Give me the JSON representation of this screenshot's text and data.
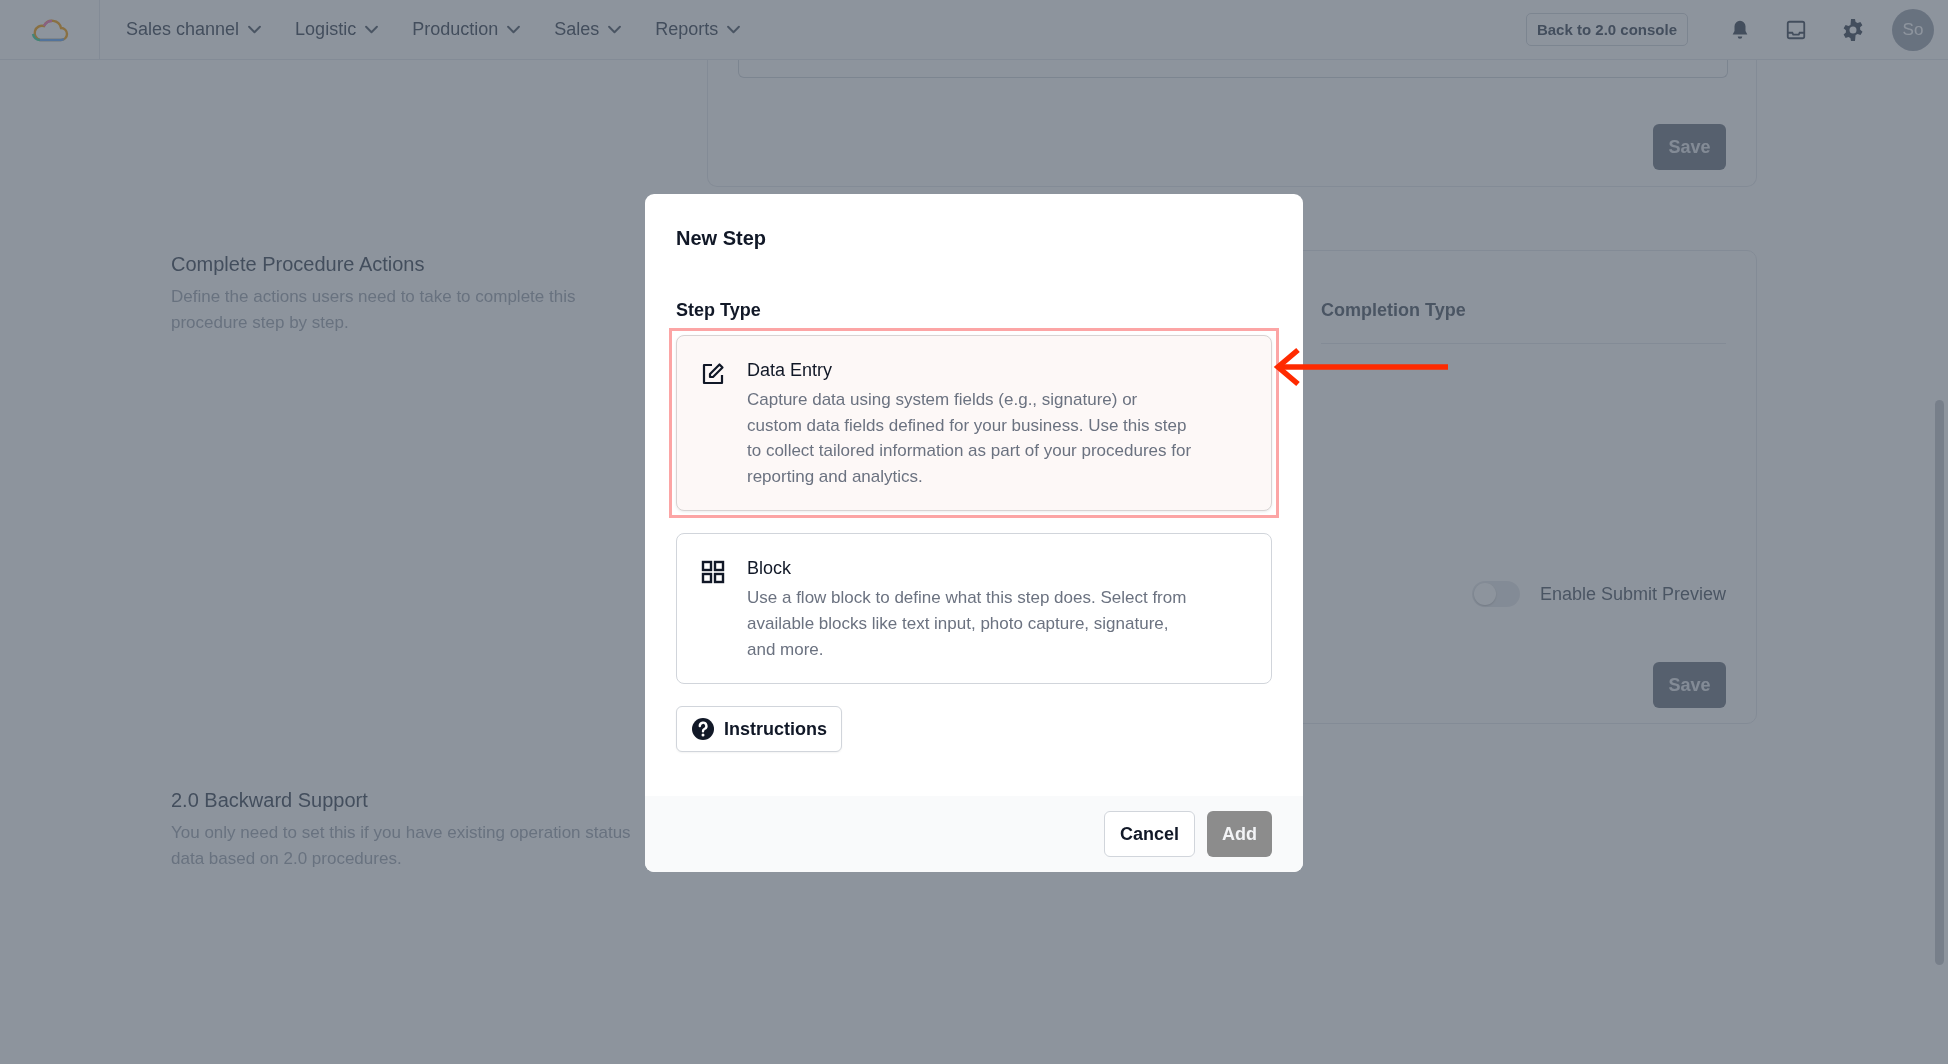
{
  "nav": {
    "items": [
      {
        "label": "Sales channel"
      },
      {
        "label": "Logistic"
      },
      {
        "label": "Production"
      },
      {
        "label": "Sales"
      },
      {
        "label": "Reports"
      }
    ],
    "console_button": "Back to 2.0 console",
    "avatar": "So"
  },
  "sections": [
    {
      "title": "Complete Procedure Actions",
      "description": "Define the actions users need to take to complete this procedure step by step."
    },
    {
      "title": "2.0 Backward Support",
      "description": "You only need to set this if you have existing operation status data based on 2.0 procedures."
    }
  ],
  "top_card": {
    "save_button": "Save"
  },
  "completion_card": {
    "column_header": "Completion Type",
    "toggle": {
      "label": "Enable Submit Preview",
      "on": false
    },
    "save_button": "Save"
  },
  "modal": {
    "title": "New Step",
    "section_label": "Step Type",
    "step_types": [
      {
        "kind": "data_entry",
        "title": "Data Entry",
        "description": "Capture data using system fields (e.g., signature) or custom data fields defined for your business. Use this step to collect tailored information as part of your procedures for reporting and analytics.",
        "selected": true
      },
      {
        "kind": "block",
        "title": "Block",
        "description": "Use a flow block to define what this step does. Select from available blocks like text input, photo capture, signature, and more.",
        "selected": false
      }
    ],
    "instructions_button": "Instructions",
    "buttons": [
      {
        "label": "Cancel",
        "kind": "secondary",
        "disabled": false
      },
      {
        "label": "Add",
        "kind": "primary",
        "disabled": true
      }
    ]
  }
}
